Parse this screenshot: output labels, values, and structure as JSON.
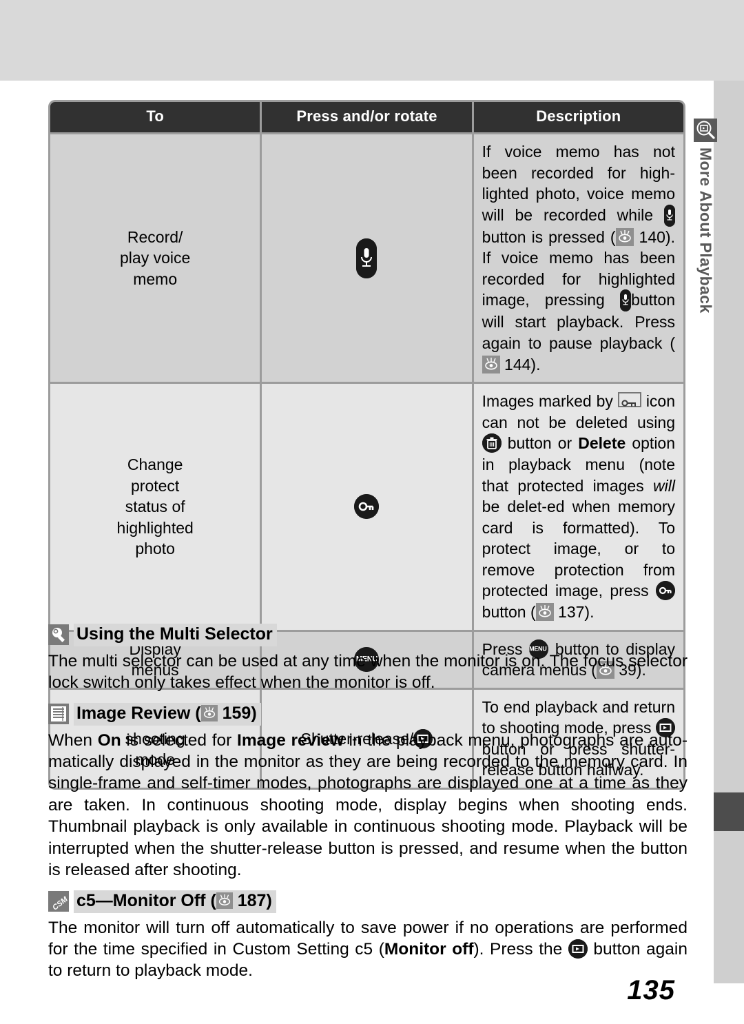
{
  "page": {
    "number": "135",
    "side_tab_label": "More About Playback",
    "side_tab_icon": "playback-magnifier-icon"
  },
  "table": {
    "headers": [
      "To",
      "Press and/or rotate",
      "Description"
    ],
    "rows": [
      {
        "to": "Record/\nplay voice\nmemo",
        "press_icon": "microphone-button-icon",
        "press_label": "",
        "description_parts": [
          {
            "type": "text",
            "value": "If voice memo has not been recorded for high-lighted photo, voice memo will be recorded while "
          },
          {
            "type": "icon",
            "value": "microphone-button-icon"
          },
          {
            "type": "text",
            "value": " button is pressed ("
          },
          {
            "type": "icon",
            "value": "page-reference-icon"
          },
          {
            "type": "text",
            "value": " 140).  If voice memo has been recorded for highlighted image, pressing "
          },
          {
            "type": "icon",
            "value": "microphone-button-icon"
          },
          {
            "type": "text",
            "value": " button will start playback.  Press again to pause playback ("
          },
          {
            "type": "icon",
            "value": "page-reference-icon"
          },
          {
            "type": "text",
            "value": " 144)."
          }
        ],
        "refs": [
          "140",
          "144"
        ],
        "shaded": true
      },
      {
        "to": "Change\nprotect\nstatus of\nhighlighted\nphoto",
        "press_icon": "key-button-icon",
        "press_label": "",
        "description_parts": [
          {
            "type": "text",
            "value": "Images marked by "
          },
          {
            "type": "icon",
            "value": "protect-key-icon"
          },
          {
            "type": "text",
            "value": " icon can not be deleted using "
          },
          {
            "type": "icon",
            "value": "trash-button-icon"
          },
          {
            "type": "text",
            "value": " button or "
          },
          {
            "type": "bold",
            "value": "Delete"
          },
          {
            "type": "text",
            "value": " option in playback menu (note that protected images "
          },
          {
            "type": "italic",
            "value": "will"
          },
          {
            "type": "text",
            "value": " be delet-ed when memory card is formatted).  To protect image, or to remove protection from protected image, press "
          },
          {
            "type": "icon",
            "value": "key-button-icon"
          },
          {
            "type": "text",
            "value": " button ("
          },
          {
            "type": "icon",
            "value": "page-reference-icon"
          },
          {
            "type": "text",
            "value": " 137)."
          }
        ],
        "refs": [
          "137"
        ],
        "shaded": false
      },
      {
        "to": "Display\nmenus",
        "press_icon": "menu-button-icon",
        "press_label": "",
        "description_parts": [
          {
            "type": "text",
            "value": "Press "
          },
          {
            "type": "icon",
            "value": "menu-button-icon"
          },
          {
            "type": "text",
            "value": " button to display camera menus ("
          },
          {
            "type": "icon",
            "value": "page-reference-icon"
          },
          {
            "type": "text",
            "value": " 39)."
          }
        ],
        "refs": [
          "39"
        ],
        "shaded": true
      },
      {
        "to": "Return to\nshooting\nmode",
        "press_icon": "playback-button-icon",
        "press_label": "Shutter-release/",
        "description_parts": [
          {
            "type": "text",
            "value": "To end playback and return to shooting mode, press "
          },
          {
            "type": "icon",
            "value": "playback-button-icon"
          },
          {
            "type": "text",
            "value": " button or press shutter-release button halfway."
          }
        ],
        "refs": [],
        "shaded": false
      }
    ]
  },
  "notes": [
    {
      "icon": "tip-lightbulb-icon",
      "title": "Using the Multi Selector",
      "ref": "",
      "body": "The multi selector can be used at any time when the monitor is on.  The focus selector lock switch only takes effect when the monitor is off."
    },
    {
      "icon": "menu-list-icon",
      "title": "Image Review",
      "ref": "159",
      "body_parts": [
        {
          "type": "text",
          "value": "When "
        },
        {
          "type": "bold",
          "value": "On"
        },
        {
          "type": "text",
          "value": " is selected for "
        },
        {
          "type": "bold",
          "value": "Image review"
        },
        {
          "type": "text",
          "value": " in the playback menu, photographs are auto-matically displayed in the monitor as they are being recorded to the memory card.  In single-frame and self-timer modes, photographs are displayed one at a time as they are taken.  In continuous shooting mode, display begins when shooting ends.  Thumbnail playback is only available in continuous shooting mode.  Playback will be interrupted when the shutter-release button is pressed, and resume when the button is released after shooting."
        }
      ]
    },
    {
      "icon": "csm-icon",
      "title": "c5—Monitor Off",
      "ref": "187",
      "body_parts": [
        {
          "type": "text",
          "value": "The monitor will turn off automatically to save power if no operations are performed for the time specified in Custom Setting c5 ("
        },
        {
          "type": "bold",
          "value": "Monitor off"
        },
        {
          "type": "text",
          "value": ").  Press the "
        },
        {
          "type": "icon",
          "value": "playback-button-icon"
        },
        {
          "type": "text",
          "value": " button again to return to playback mode."
        }
      ]
    }
  ],
  "colors": {
    "band": "#d9d9d9",
    "header_bar": "#313131",
    "row_light": "#e6e6e6",
    "row_shade": "#d2d2d2",
    "icon_gray": "#7a7a7a",
    "button_black": "#1a1a1a"
  }
}
